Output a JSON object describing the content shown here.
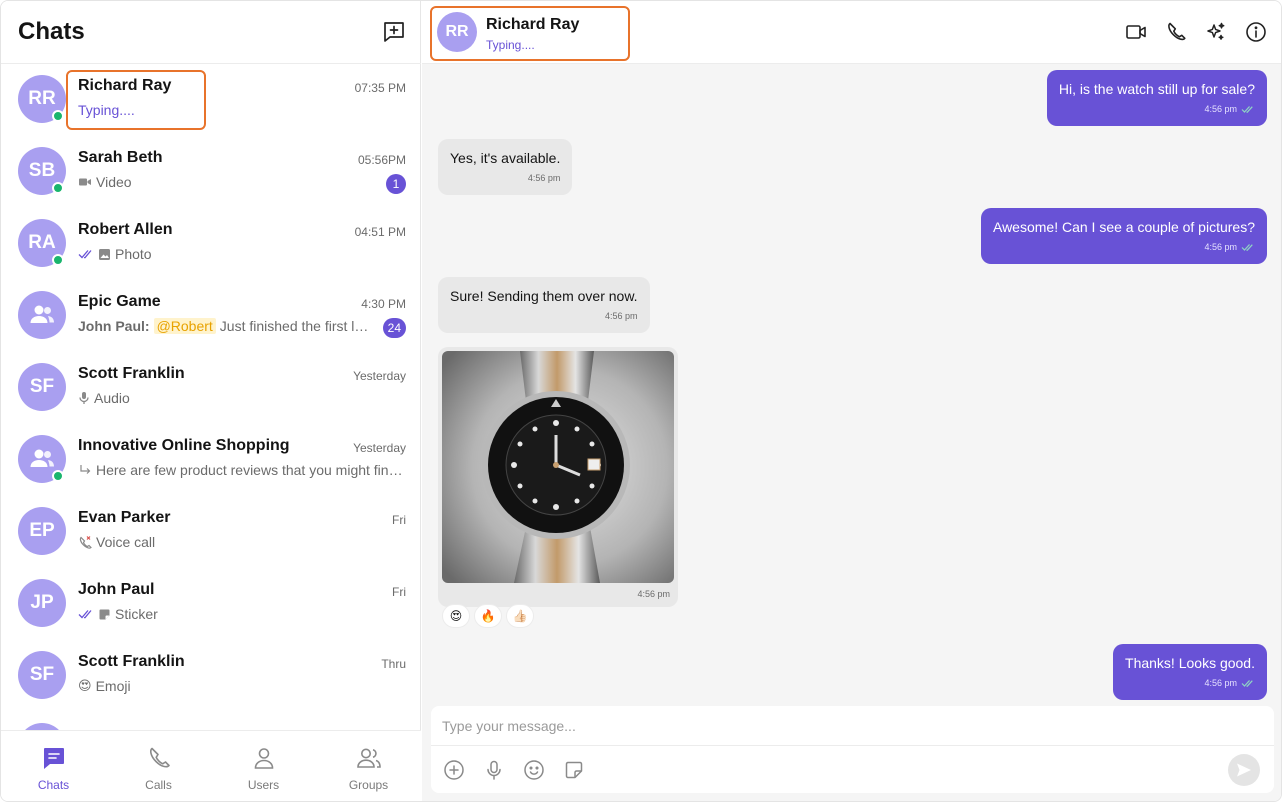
{
  "sidebar": {
    "title": "Chats",
    "chats": [
      {
        "initials": "RR",
        "name": "Richard Ray",
        "time": "07:35 PM",
        "subtitle": "Typing....",
        "online": true
      },
      {
        "initials": "SB",
        "name": "Sarah Beth",
        "time": "05:56PM",
        "subtitle": "Video",
        "badge": "1",
        "online": true
      },
      {
        "initials": "RA",
        "name": "Robert Allen",
        "time": "04:51 PM",
        "subtitle": "Photo",
        "online": true
      },
      {
        "initials": "",
        "name": "Epic Game",
        "time": "4:30 PM",
        "sender": "John Paul:",
        "mention": "@Robert",
        "subtitle": "Just finished the first level of the game",
        "badge": "24"
      },
      {
        "initials": "SF",
        "name": "Scott Franklin",
        "time": "Yesterday",
        "subtitle": "Audio"
      },
      {
        "initials": "",
        "name": "Innovative Online Shopping",
        "time": "Yesterday",
        "subtitle": "Here are few product reviews that you might find useful",
        "online": true
      },
      {
        "initials": "EP",
        "name": "Evan Parker",
        "time": "Fri",
        "subtitle": "Voice call"
      },
      {
        "initials": "JP",
        "name": "John Paul",
        "time": "Fri",
        "subtitle": "Sticker"
      },
      {
        "initials": "SF",
        "name": "Scott Franklin",
        "time": "Thru",
        "subtitle": "Emoji"
      }
    ]
  },
  "nav": {
    "chats": "Chats",
    "calls": "Calls",
    "users": "Users",
    "groups": "Groups"
  },
  "header": {
    "initials": "RR",
    "name": "Richard Ray",
    "status": "Typing...."
  },
  "messages": [
    {
      "text": "Hi, is the watch still up for sale?",
      "time": "4:56 pm"
    },
    {
      "text": "Yes, it's available.",
      "time": "4:56 pm"
    },
    {
      "text": "Awesome! Can I see a couple of pictures?",
      "time": "4:56 pm"
    },
    {
      "text": "Sure! Sending them over now.",
      "time": "4:56 pm"
    },
    {
      "text": "Thanks! Looks good.",
      "time": "4:56 pm"
    }
  ],
  "image_message": {
    "time": "4:56 pm",
    "reactions": [
      "😍",
      "🔥",
      "👍🏻"
    ]
  },
  "composer": {
    "placeholder": "Type your message..."
  },
  "colors": {
    "accent": "#6852d6",
    "avatar": "#a99ff0",
    "online": "#19b56d",
    "highlight": "#e8732b"
  }
}
